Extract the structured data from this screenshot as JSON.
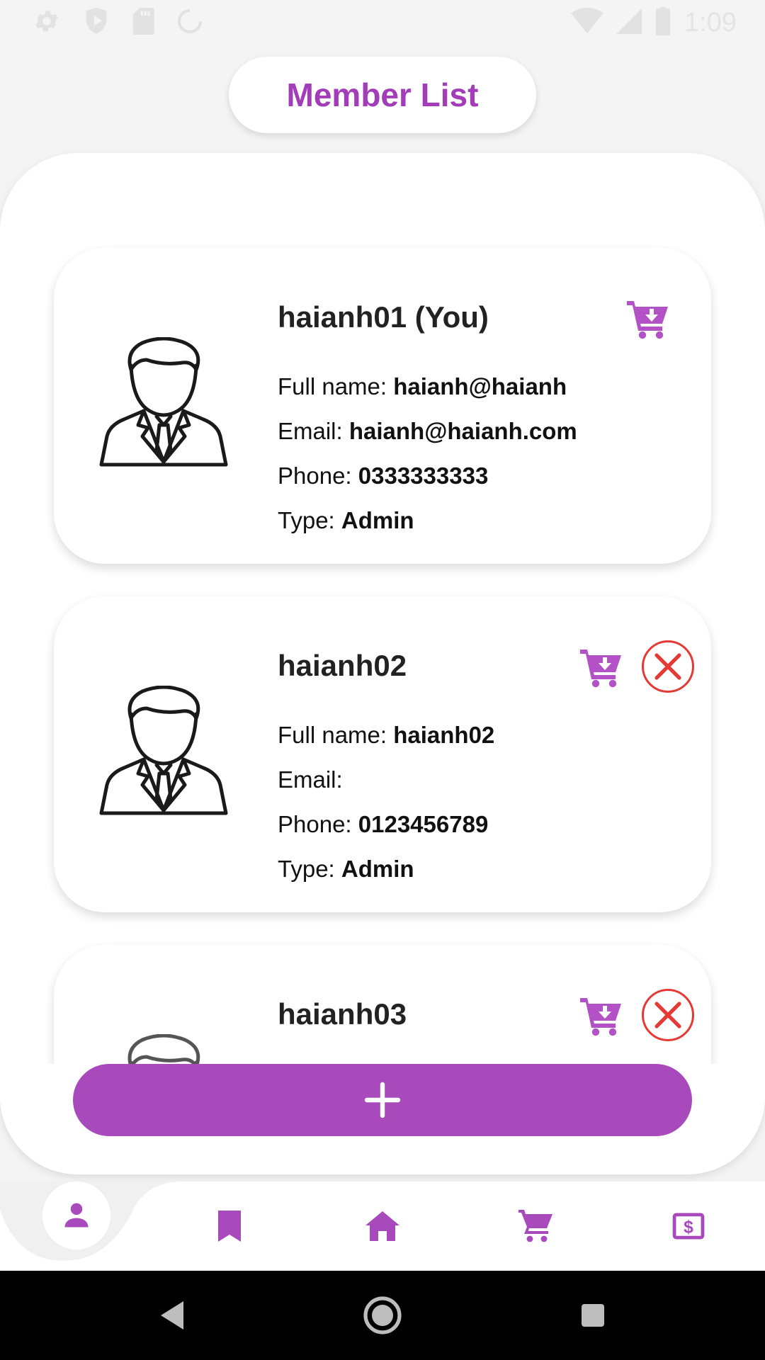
{
  "status_bar": {
    "time": "1:09",
    "icons": [
      "gear-icon",
      "shield-play-icon",
      "sd-card-icon",
      "sync-icon",
      "wifi-icon",
      "signal-icon",
      "battery-icon"
    ]
  },
  "header": {
    "title": "Member List"
  },
  "labels": {
    "full_name": "Full name: ",
    "email": "Email: ",
    "phone": "Phone: ",
    "type": "Type: "
  },
  "members": [
    {
      "username": "haianh01 (You)",
      "full_name": "haianh@haianh",
      "email": "haianh@haianh.com",
      "phone": "0333333333",
      "type": "Admin",
      "can_delete": false
    },
    {
      "username": "haianh02",
      "full_name": "haianh02",
      "email": "",
      "phone": "0123456789",
      "type": "Admin",
      "can_delete": true
    },
    {
      "username": "haianh03",
      "can_delete": true
    }
  ],
  "add_button": {
    "icon": "plus-icon"
  },
  "bottom_nav": {
    "items": [
      "person-icon",
      "bookmark-icon",
      "home-icon",
      "cart-icon",
      "money-icon"
    ],
    "active": "person-icon"
  },
  "colors": {
    "accent": "#a94abc",
    "title": "#a23cb8",
    "icon": "#b352c7",
    "danger": "#e53935",
    "background": "#f4f4f4"
  }
}
